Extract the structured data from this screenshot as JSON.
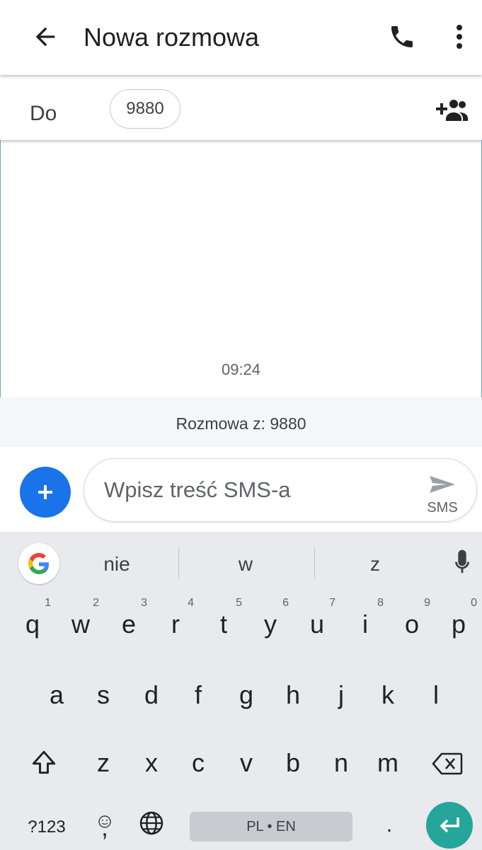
{
  "header": {
    "title": "Nowa rozmowa",
    "back_icon": "arrow-back-icon",
    "call_icon": "phone-icon",
    "more_icon": "more-vert-icon"
  },
  "recipient_bar": {
    "label": "Do",
    "chip": "9880",
    "add_icon": "add-people-icon"
  },
  "conversation": {
    "timestamp": "09:24",
    "info": "Rozmowa z: 9880"
  },
  "composer": {
    "placeholder": "Wpisz treść SMS-a",
    "send_label": "SMS",
    "attach_icon": "plus-icon",
    "send_icon": "send-icon"
  },
  "keyboard": {
    "suggestions": [
      "nie",
      "w",
      "z"
    ],
    "row1": [
      {
        "k": "q",
        "n": "1"
      },
      {
        "k": "w",
        "n": "2"
      },
      {
        "k": "e",
        "n": "3"
      },
      {
        "k": "r",
        "n": "4"
      },
      {
        "k": "t",
        "n": "5"
      },
      {
        "k": "y",
        "n": "6"
      },
      {
        "k": "u",
        "n": "7"
      },
      {
        "k": "i",
        "n": "8"
      },
      {
        "k": "o",
        "n": "9"
      },
      {
        "k": "p",
        "n": "0"
      }
    ],
    "row2": [
      "a",
      "s",
      "d",
      "f",
      "g",
      "h",
      "j",
      "k",
      "l"
    ],
    "row3": [
      "z",
      "x",
      "c",
      "v",
      "b",
      "n",
      "m"
    ],
    "symbols_key": "?123",
    "comma_key": ",",
    "space_label": "PL • EN",
    "period_key": ".",
    "accent_color": "#26a69a"
  }
}
